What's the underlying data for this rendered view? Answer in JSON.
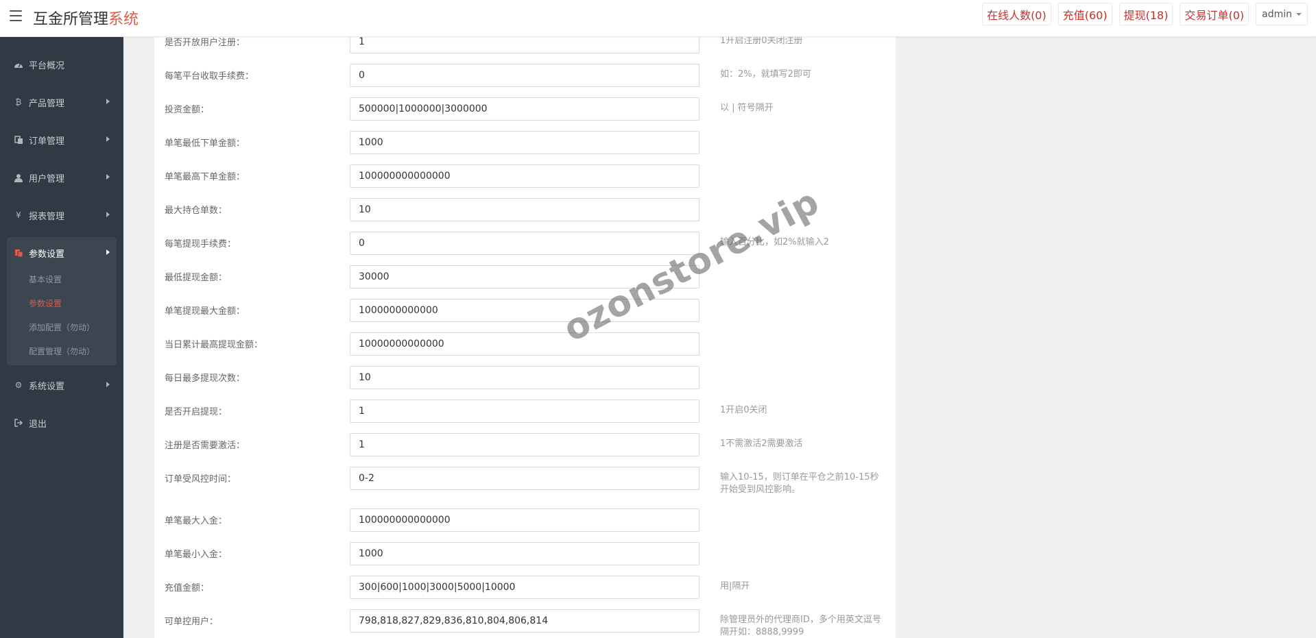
{
  "header": {
    "title_main": "互金所管理",
    "title_accent": "系统",
    "buttons": [
      {
        "label": "在线人数(0)"
      },
      {
        "label": "充值(60)"
      },
      {
        "label": "提现(18)"
      },
      {
        "label": "交易订单(0)"
      }
    ],
    "user": "admin"
  },
  "sidebar": {
    "items": [
      {
        "label": "平台概况",
        "icon": "dashboard-icon"
      },
      {
        "label": "产品管理",
        "icon": "bitcoin-icon"
      },
      {
        "label": "订单管理",
        "icon": "copy-icon"
      },
      {
        "label": "用户管理",
        "icon": "user-icon"
      },
      {
        "label": "报表管理",
        "icon": "yen-icon"
      },
      {
        "label": "参数设置",
        "icon": "files-icon"
      },
      {
        "label": "系统设置",
        "icon": "cogs-icon"
      },
      {
        "label": "退出",
        "icon": "sign-out-icon"
      }
    ],
    "subitems": [
      {
        "label": "基本设置"
      },
      {
        "label": "参数设置"
      },
      {
        "label": "添加配置（勿动）"
      },
      {
        "label": "配置管理（勿动）"
      }
    ]
  },
  "form": {
    "rows": [
      {
        "label": "是否开放用户注册：",
        "value": "1",
        "hint": "1开启注册0关闭注册"
      },
      {
        "label": "每笔平台收取手续费：",
        "value": "0",
        "hint": "如：2%，就填写2即可"
      },
      {
        "label": "投资金额：",
        "value": "500000|1000000|3000000",
        "hint": "以 | 符号隔开"
      },
      {
        "label": "单笔最低下单金额：",
        "value": "1000",
        "hint": ""
      },
      {
        "label": "单笔最高下单金额：",
        "value": "100000000000000",
        "hint": ""
      },
      {
        "label": "最大持仓单数：",
        "value": "10",
        "hint": ""
      },
      {
        "label": "每笔提现手续费：",
        "value": "0",
        "hint": "输入百分比，如2%就输入2"
      },
      {
        "label": "最低提现金额：",
        "value": "30000",
        "hint": ""
      },
      {
        "label": "单笔提现最大金额：",
        "value": "1000000000000",
        "hint": ""
      },
      {
        "label": "当日累计最高提现金额：",
        "value": "10000000000000",
        "hint": ""
      },
      {
        "label": "每日最多提现次数：",
        "value": "10",
        "hint": ""
      },
      {
        "label": "是否开启提现：",
        "value": "1",
        "hint": "1开启0关闭"
      },
      {
        "label": "注册是否需要激活：",
        "value": "1",
        "hint": "1不需激活2需要激活"
      },
      {
        "label": "订单受风控时间：",
        "value": "0-2",
        "hint": "输入10-15，则订单在平仓之前10-15秒开始受到风控影响。"
      },
      {
        "label": "单笔最大入金：",
        "value": "100000000000000",
        "hint": ""
      },
      {
        "label": "单笔最小入金：",
        "value": "1000",
        "hint": ""
      },
      {
        "label": "充值金额：",
        "value": "300|600|1000|3000|5000|10000",
        "hint": "用|隔开"
      },
      {
        "label": "可单控用户：",
        "value": "798,818,827,829,836,810,804,806,814",
        "hint": "除管理员外的代理商ID，多个用英文逗号隔开如：8888,9999"
      }
    ]
  },
  "watermark": "ozonstore.vip"
}
